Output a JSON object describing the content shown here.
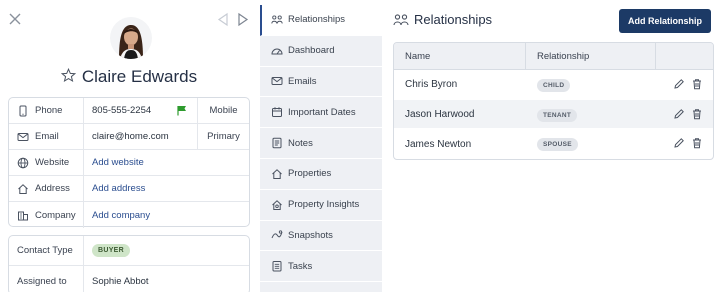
{
  "contact": {
    "name": "Claire Edwards",
    "details": [
      {
        "label": "Phone",
        "icon": "phone-icon",
        "value": "805-555-2254",
        "link": false,
        "flag": true,
        "kind": "Mobile"
      },
      {
        "label": "Email",
        "icon": "email-icon",
        "value": "claire@home.com",
        "link": false,
        "kind": "Primary"
      },
      {
        "label": "Website",
        "icon": "globe-icon",
        "value": "Add website",
        "link": true
      },
      {
        "label": "Address",
        "icon": "home-icon",
        "value": "Add address",
        "link": true
      },
      {
        "label": "Company",
        "icon": "building-icon",
        "value": "Add company",
        "link": true
      }
    ],
    "contact_type_label": "Contact Type",
    "contact_type_value": "BUYER",
    "assigned_to_label": "Assigned to",
    "assigned_to_value": "Sophie Abbot"
  },
  "sidebar": {
    "items": [
      {
        "label": "Relationships",
        "icon": "relationships-icon",
        "active": true
      },
      {
        "label": "Dashboard",
        "icon": "dashboard-icon"
      },
      {
        "label": "Emails",
        "icon": "email-icon"
      },
      {
        "label": "Important Dates",
        "icon": "calendar-icon"
      },
      {
        "label": "Notes",
        "icon": "notes-icon"
      },
      {
        "label": "Properties",
        "icon": "home-icon"
      },
      {
        "label": "Property Insights",
        "icon": "property-insights-icon"
      },
      {
        "label": "Snapshots",
        "icon": "snapshots-icon"
      },
      {
        "label": "Tasks",
        "icon": "tasks-icon"
      }
    ]
  },
  "main": {
    "title": "Relationships",
    "add_button": "Add Relationship",
    "columns": [
      "Name",
      "Relationship"
    ],
    "rows": [
      {
        "name": "Chris Byron",
        "relationship": "CHILD"
      },
      {
        "name": "Jason Harwood",
        "relationship": "TENANT"
      },
      {
        "name": "James Newton",
        "relationship": "SPOUSE"
      }
    ]
  },
  "colors": {
    "accent": "#1c3a66",
    "link": "#2a4d8f",
    "flag": "#2e9b2e",
    "buyer_pill": "#cfe5c8"
  }
}
